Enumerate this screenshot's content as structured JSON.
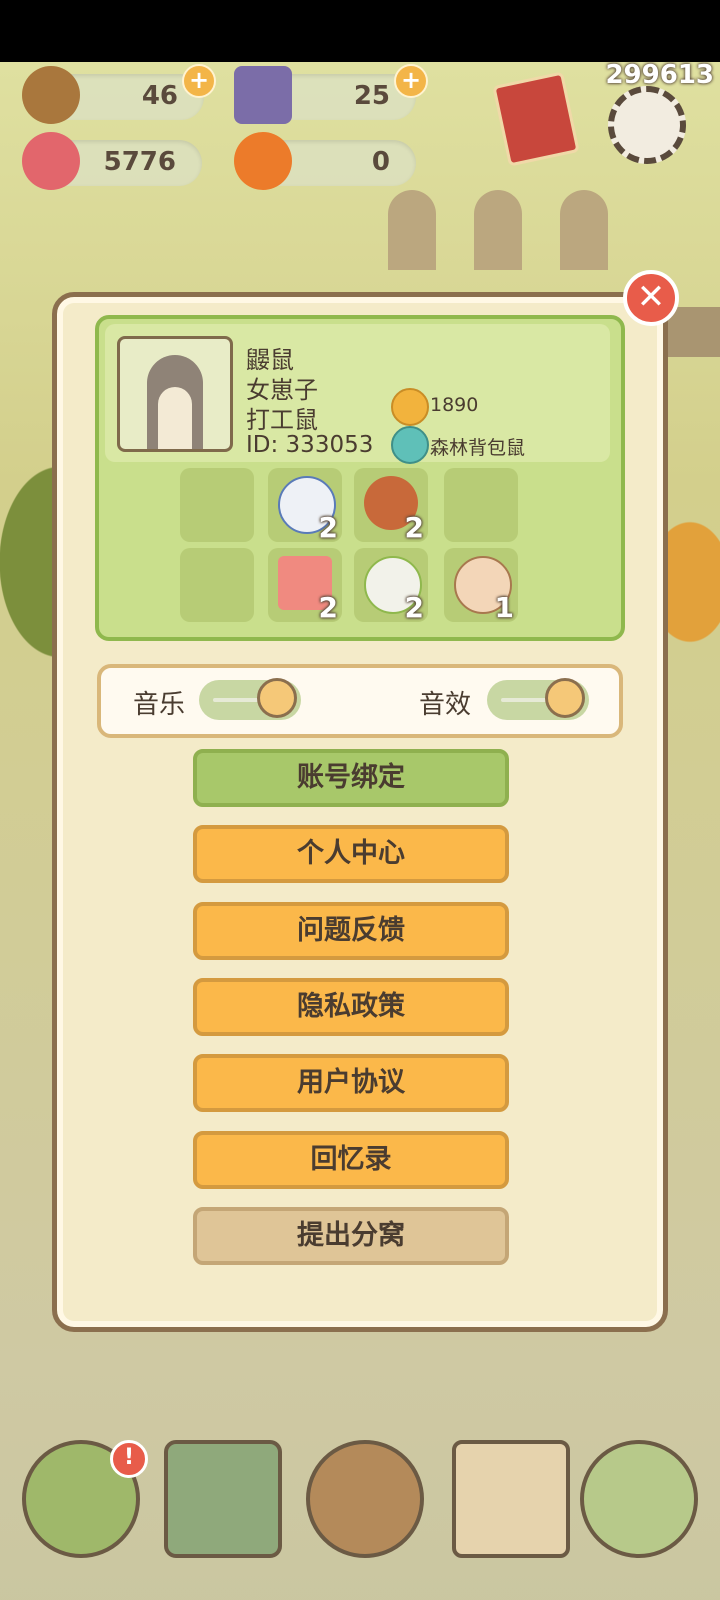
{
  "hud": {
    "acorn_count": "46",
    "gem_count": "25",
    "heart_count": "5776",
    "pumpkin_count": "0",
    "coord_readout": "299613",
    "plus_symbol": "+"
  },
  "modal": {
    "close_symbol": "✕",
    "profile": {
      "name": "鼹鼠",
      "gender": "女崽子",
      "title": "打工鼠",
      "id": "ID: 333053",
      "bell_count": "1890",
      "badge_name": "森林背包鼠"
    },
    "inventory": [
      {
        "icon": "teapot-icon",
        "count": "2"
      },
      {
        "icon": "acorn-icon",
        "count": "2"
      },
      {
        "icon": "cards-icon",
        "count": "2"
      },
      {
        "icon": "turnip-icon",
        "count": "2"
      },
      {
        "icon": "paw-icon",
        "count": "1"
      }
    ],
    "sound": {
      "music_label": "音乐",
      "sfx_label": "音效"
    },
    "buttons": {
      "account_bind": "账号绑定",
      "personal_center": "个人中心",
      "feedback": "问题反馈",
      "privacy_policy": "隐私政策",
      "user_agreement": "用户协议",
      "memoir": "回忆录",
      "leave_nest": "提出分窝"
    }
  },
  "nav": {
    "alert_symbol": "!"
  },
  "colors": {
    "accent_orange": "#fbb84a",
    "accent_green": "#a8c86a",
    "frame_brown": "#8b6f4e",
    "close_red": "#e85c4a"
  }
}
